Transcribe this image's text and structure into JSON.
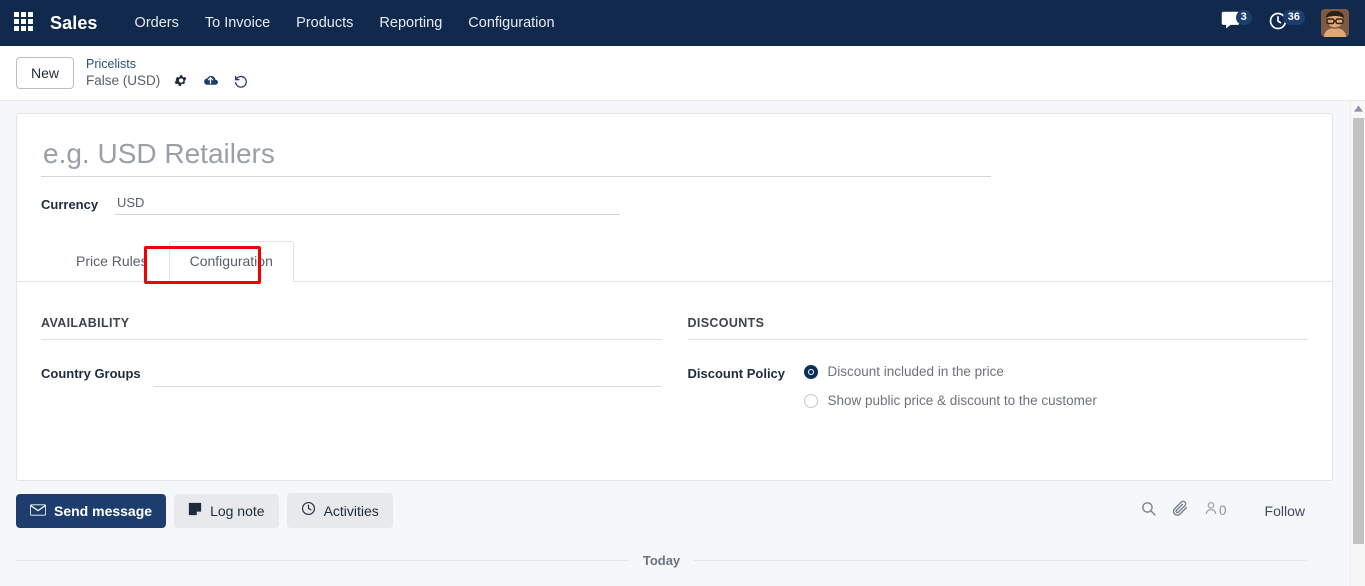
{
  "navbar": {
    "apps_icon": "apps-grid-icon",
    "brand": "Sales",
    "menu": [
      {
        "label": "Orders"
      },
      {
        "label": "To Invoice"
      },
      {
        "label": "Products"
      },
      {
        "label": "Reporting"
      },
      {
        "label": "Configuration"
      }
    ],
    "messages_icon": "chat-bubble-icon",
    "messages_count": "3",
    "activities_icon": "clock-icon",
    "activities_count": "36",
    "avatar_icon": "user-avatar",
    "bg_color": "#11294d"
  },
  "control_panel": {
    "new_button": "New",
    "breadcrumb_parent": "Pricelists",
    "breadcrumb_current": "False (USD)",
    "settings_icon": "gear-icon",
    "save_icon": "cloud-upload-icon",
    "discard_icon": "undo-icon"
  },
  "form": {
    "title_placeholder": "e.g. USD Retailers",
    "title_value": "",
    "currency_label": "Currency",
    "currency_value": "USD"
  },
  "notebook": {
    "tabs": [
      {
        "label": "Price Rules",
        "active": false
      },
      {
        "label": "Configuration",
        "active": true
      }
    ],
    "highlight_color": "#f50000"
  },
  "availability": {
    "group_title": "AVAILABILITY",
    "country_groups_label": "Country Groups",
    "country_groups_value": ""
  },
  "discounts": {
    "group_title": "DISCOUNTS",
    "discount_policy_label": "Discount Policy",
    "options": [
      {
        "label": "Discount included in the price",
        "selected": true
      },
      {
        "label": "Show public price & discount to the customer",
        "selected": false
      }
    ]
  },
  "chatter": {
    "send_message": "Send message",
    "send_message_icon": "envelope-icon",
    "log_note": "Log note",
    "log_note_icon": "sticky-note-icon",
    "activities": "Activities",
    "activities_icon": "clock-icon",
    "search_icon": "search-icon",
    "attachment_icon": "paperclip-icon",
    "followers_icon": "user-icon",
    "followers_count": "0",
    "follow_label": "Follow",
    "today_separator": "Today"
  },
  "scrollbar": {
    "up_arrow_icon": "caret-up-icon"
  }
}
